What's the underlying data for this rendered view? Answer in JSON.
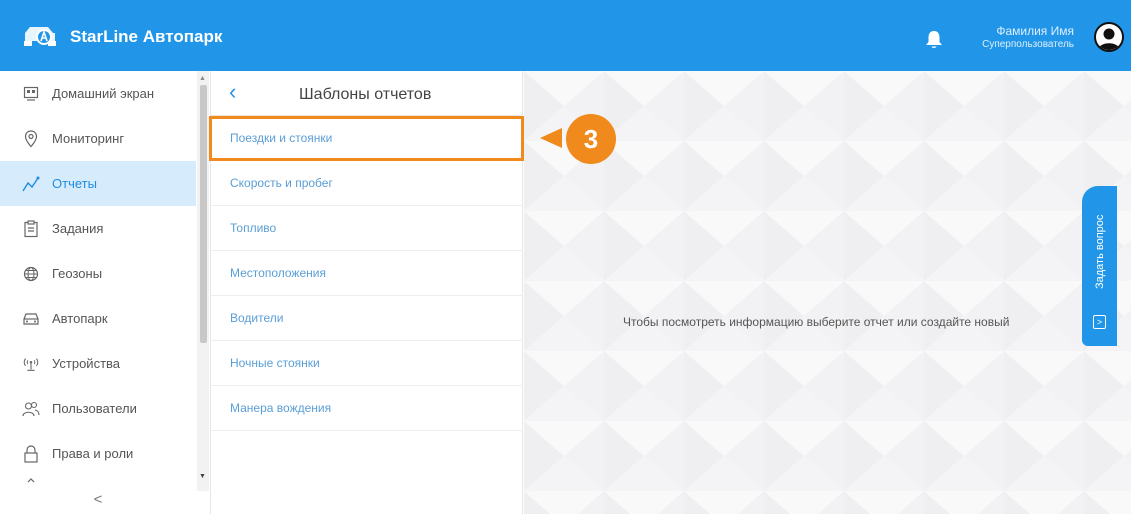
{
  "header": {
    "app_title": "StarLine Автопарк",
    "user_name": "Фамилия Имя",
    "user_role": "Суперпользователь",
    "bg_color": "#2196e8"
  },
  "sidebar": {
    "items": [
      {
        "label": "Домашний экран",
        "icon": "home-screen-icon"
      },
      {
        "label": "Мониторинг",
        "icon": "location-pin-icon"
      },
      {
        "label": "Отчеты",
        "icon": "chart-line-icon",
        "active": true
      },
      {
        "label": "Задания",
        "icon": "clipboard-icon"
      },
      {
        "label": "Геозоны",
        "icon": "globe-icon"
      },
      {
        "label": "Автопарк",
        "icon": "car-icon"
      },
      {
        "label": "Устройства",
        "icon": "antenna-icon"
      },
      {
        "label": "Пользователи",
        "icon": "users-icon"
      },
      {
        "label": "Права и роли",
        "icon": "lock-icon"
      }
    ],
    "collapse_glyph": "<"
  },
  "panel": {
    "title": "Шаблоны отчетов",
    "templates": [
      "Поездки и стоянки",
      "Скорость и пробег",
      "Топливо",
      "Местоположения",
      "Водители",
      "Ночные стоянки",
      "Манера вождения"
    ]
  },
  "callout": {
    "step": "3",
    "color": "#f08a1c"
  },
  "main": {
    "empty_message": "Чтобы посмотреть информацию выберите отчет или создайте новый"
  },
  "ask_tab": {
    "label": "Задать вопрос"
  }
}
